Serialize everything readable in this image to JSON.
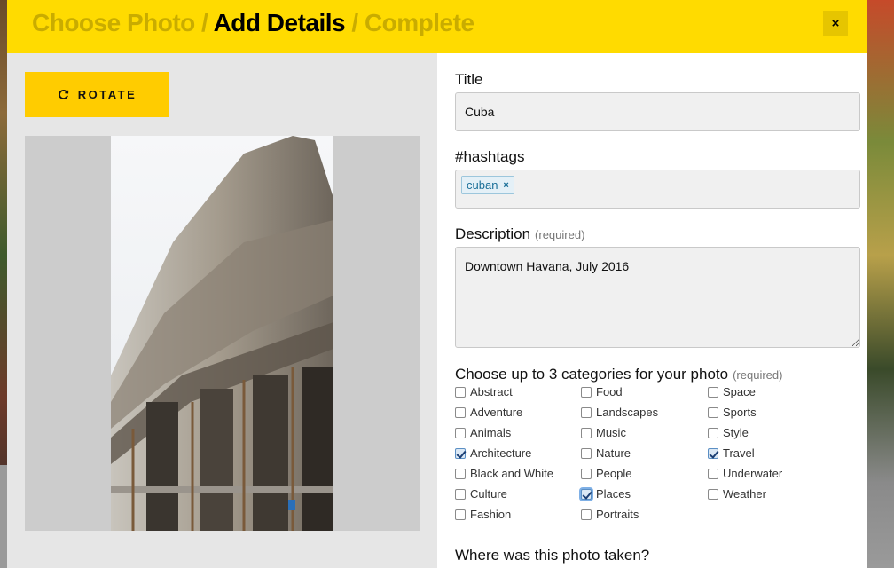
{
  "header": {
    "step1": "Choose Photo",
    "sep1": " / ",
    "step2": "Add Details",
    "sep2": " / ",
    "step3": "Complete",
    "close": "×"
  },
  "rotate": {
    "label": "ROTATE",
    "icon": "rotate-icon"
  },
  "form": {
    "title_label": "Title",
    "title_value": "Cuba",
    "hashtags_label": "#hashtags",
    "tags": [
      {
        "text": "cuban",
        "remove": "×"
      }
    ],
    "description_label": "Description",
    "description_req": "(required)",
    "description_value": "Downtown Havana, July 2016",
    "categories_label": "Choose up to 3 categories for your photo",
    "categories_req": "(required)",
    "categories": [
      {
        "label": "Abstract",
        "checked": false
      },
      {
        "label": "Food",
        "checked": false
      },
      {
        "label": "Space",
        "checked": false
      },
      {
        "label": "Adventure",
        "checked": false
      },
      {
        "label": "Landscapes",
        "checked": false
      },
      {
        "label": "Sports",
        "checked": false
      },
      {
        "label": "Animals",
        "checked": false
      },
      {
        "label": "Music",
        "checked": false
      },
      {
        "label": "Style",
        "checked": false
      },
      {
        "label": "Architecture",
        "checked": true
      },
      {
        "label": "Nature",
        "checked": false
      },
      {
        "label": "Travel",
        "checked": true
      },
      {
        "label": "Black and White",
        "checked": false
      },
      {
        "label": "People",
        "checked": false
      },
      {
        "label": "Underwater",
        "checked": false
      },
      {
        "label": "Culture",
        "checked": false
      },
      {
        "label": "Places",
        "checked": true
      },
      {
        "label": "Weather",
        "checked": false
      },
      {
        "label": "Fashion",
        "checked": false
      },
      {
        "label": "Portraits",
        "checked": false
      }
    ],
    "location_label": "Where was this photo taken?"
  },
  "colors": {
    "header": "#ffdb00",
    "rotate": "#ffcc00",
    "tag": "#1a6f98"
  }
}
